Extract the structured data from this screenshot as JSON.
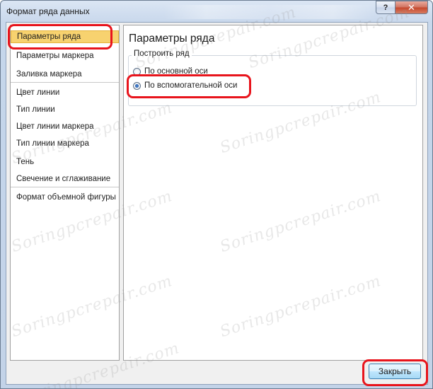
{
  "window": {
    "title": "Формат ряда данных",
    "help_label": "?",
    "close_label": "✕"
  },
  "sidebar": {
    "items": [
      {
        "label": "Параметры ряда",
        "selected": true
      },
      {
        "label": "Параметры маркера"
      },
      {
        "label": "Заливка маркера"
      },
      {
        "label": "Цвет линии"
      },
      {
        "label": "Тип линии"
      },
      {
        "label": "Цвет линии маркера"
      },
      {
        "label": "Тип линии маркера"
      },
      {
        "label": "Тень"
      },
      {
        "label": "Свечение и сглаживание"
      },
      {
        "label": "Формат объемной фигуры"
      }
    ]
  },
  "panel": {
    "title": "Параметры ряда",
    "group_label": "Построить ряд",
    "options": [
      {
        "label": "По основной оси",
        "checked": false
      },
      {
        "label": "По вспомогательной оси",
        "checked": true
      }
    ]
  },
  "footer": {
    "close_button": "Закрыть"
  },
  "watermark": "Soringpcrepair.com",
  "colors": {
    "highlight": "#e8141c",
    "selection": "#f7d26f"
  }
}
